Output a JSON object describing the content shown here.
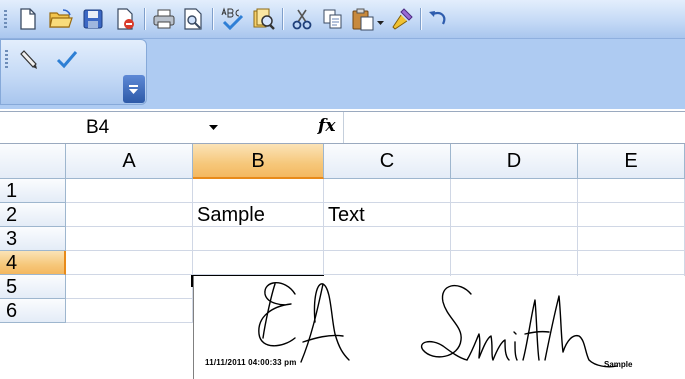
{
  "standard_toolbar": {
    "buttons": [
      {
        "name": "new-document-icon"
      },
      {
        "name": "open-folder-icon"
      },
      {
        "name": "save-disk-icon"
      },
      {
        "name": "permission-icon"
      },
      {
        "name": "print-icon"
      },
      {
        "name": "print-preview-icon"
      },
      {
        "name": "spelling-check-icon"
      },
      {
        "name": "research-icon"
      },
      {
        "name": "cut-scissors-icon"
      },
      {
        "name": "copy-icon"
      },
      {
        "name": "paste-clipboard-icon"
      },
      {
        "name": "format-painter-icon"
      },
      {
        "name": "undo-icon"
      }
    ]
  },
  "ink_toolbar": {
    "buttons": [
      {
        "name": "pen-icon"
      },
      {
        "name": "checkmark-icon"
      }
    ]
  },
  "formula_bar": {
    "name_box": "B4",
    "fx_label": "fx",
    "formula": ""
  },
  "sheet": {
    "columns": [
      "A",
      "B",
      "C",
      "D",
      "E"
    ],
    "active_column": "B",
    "rows": [
      "1",
      "2",
      "3",
      "4",
      "5",
      "6"
    ],
    "active_row": "4",
    "cells": [
      {
        "ref": "B2",
        "value": "Sample"
      },
      {
        "ref": "C2",
        "value": "Text"
      }
    ]
  },
  "signature": {
    "handwriting": "EA Smith",
    "timestamp": "11/11/2011 04:00:33 pm",
    "caption": "Sample"
  },
  "colors": {
    "toolbar_light": "#e3eefc",
    "toolbar_dark": "#a9c6ee",
    "active_header": "#f6c77a",
    "active_header_edge": "#e88a1a",
    "gridline": "#d0d7e5",
    "header_border": "#9eb6ce"
  }
}
